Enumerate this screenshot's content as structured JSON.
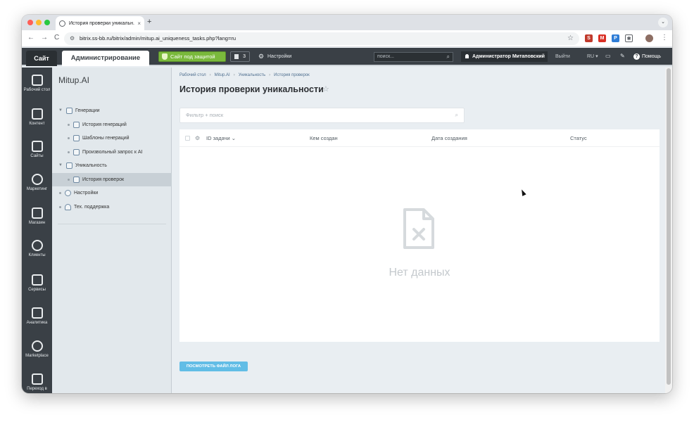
{
  "browser": {
    "tab_title": "История проверки уникальн...",
    "tab_close": "×",
    "new_tab": "+",
    "menu": "⌄",
    "url": "bitrix.ss-bb.ru/bitrix/admin/mitup.ai_uniqueness_tasks.php?lang=ru",
    "back": "←",
    "forward": "→",
    "reload": "C",
    "kebab": "⋮"
  },
  "top_panel": {
    "site_tab": "Сайт",
    "admin_tab": "Администрирование",
    "protection": "Сайт под защитой",
    "updates_count": "3",
    "settings": "Настройки",
    "search_placeholder": "поиск...",
    "user": "Администратор Митаповский",
    "logout": "Выйти",
    "lang": "RU",
    "help": "Помощь"
  },
  "left_menu": [
    {
      "label": "Рабочий стол",
      "icon": "home-icon"
    },
    {
      "label": "Контент",
      "icon": "content-icon"
    },
    {
      "label": "Сайты",
      "icon": "calendar-icon"
    },
    {
      "label": "Маркетинг",
      "icon": "target-icon"
    },
    {
      "label": "Магазин",
      "icon": "cart-icon"
    },
    {
      "label": "Клиенты",
      "icon": "clients-icon"
    },
    {
      "label": "Сервисы",
      "icon": "layers-icon"
    },
    {
      "label": "Аналитика",
      "icon": "chart-icon"
    },
    {
      "label": "Marketplace",
      "icon": "cloud-icon"
    },
    {
      "label": "Переход в",
      "icon": "edit-icon"
    }
  ],
  "tree": {
    "title": "Mitup.AI",
    "items": [
      {
        "label": "Генерации"
      },
      {
        "label": "История генераций"
      },
      {
        "label": "Шаблоны генераций"
      },
      {
        "label": "Произвольный запрос к AI"
      },
      {
        "label": "Уникальность"
      },
      {
        "label": "История проверок"
      },
      {
        "label": "Настройки"
      },
      {
        "label": "Тех. поддержка"
      }
    ]
  },
  "breadcrumbs": [
    "Рабочий стол",
    "Mitup.AI",
    "Уникальность",
    "История проверок"
  ],
  "page": {
    "title": "История проверки уникальности",
    "filter_placeholder": "Фильтр + поиск",
    "columns": [
      "ID задачи",
      "Кем создан",
      "Дата создания",
      "Статус"
    ],
    "empty_text": "Нет данных",
    "log_button": "ПОСМОТРЕТЬ ФАЙЛ ЛОГА"
  },
  "colors": {
    "panel_dark": "#3a4046",
    "protect_green": "#7ab93c",
    "log_button_blue": "#62bde6",
    "background": "#e9eef2"
  }
}
